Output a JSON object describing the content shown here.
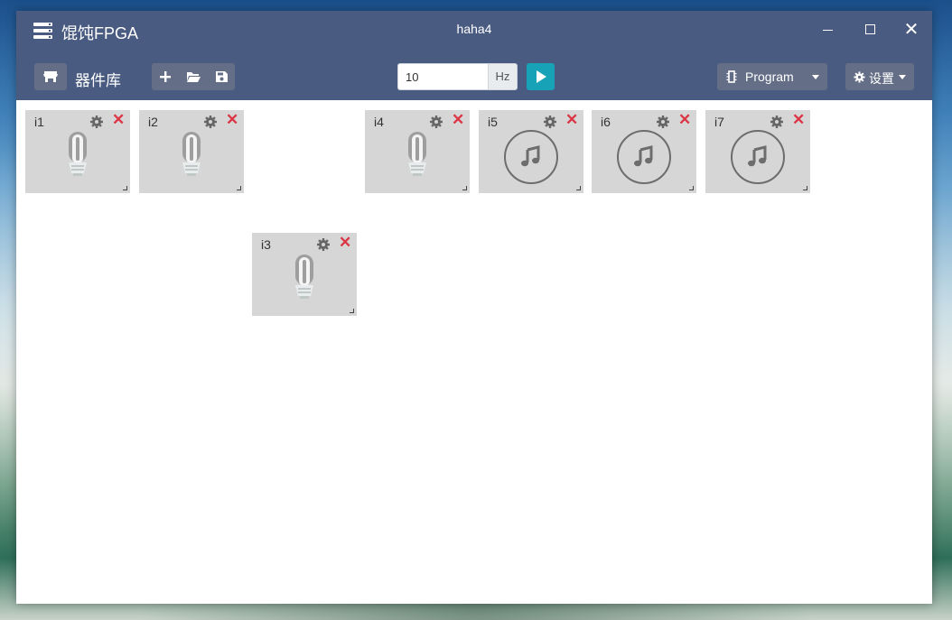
{
  "window": {
    "app_title": "馄饨FPGA",
    "doc_title": "haha4",
    "controls": [
      "minimize-icon",
      "maximize-icon",
      "close-icon"
    ],
    "close_glyph": "✕"
  },
  "toolbar": {
    "library_label": "器件库",
    "file_actions": [
      "plus-icon",
      "folder-open-icon",
      "save-icon"
    ],
    "frequency_value": "10",
    "frequency_unit": "Hz",
    "program_label": "Program",
    "settings_label": "设置"
  },
  "components": [
    {
      "id": "i1",
      "type": "bulb-icon"
    },
    {
      "id": "i2",
      "type": "bulb-icon"
    },
    {
      "id": "i4",
      "type": "bulb-icon"
    },
    {
      "id": "i5",
      "type": "music-note-icon"
    },
    {
      "id": "i6",
      "type": "music-note-icon"
    },
    {
      "id": "i7",
      "type": "music-note-icon"
    },
    {
      "id": "i3",
      "type": "bulb-icon"
    }
  ],
  "colors": {
    "titlebar": "#4a5b82",
    "button": "#646f87",
    "accent": "#17a2b8",
    "danger": "#dc3545",
    "card": "#d6d6d6"
  }
}
